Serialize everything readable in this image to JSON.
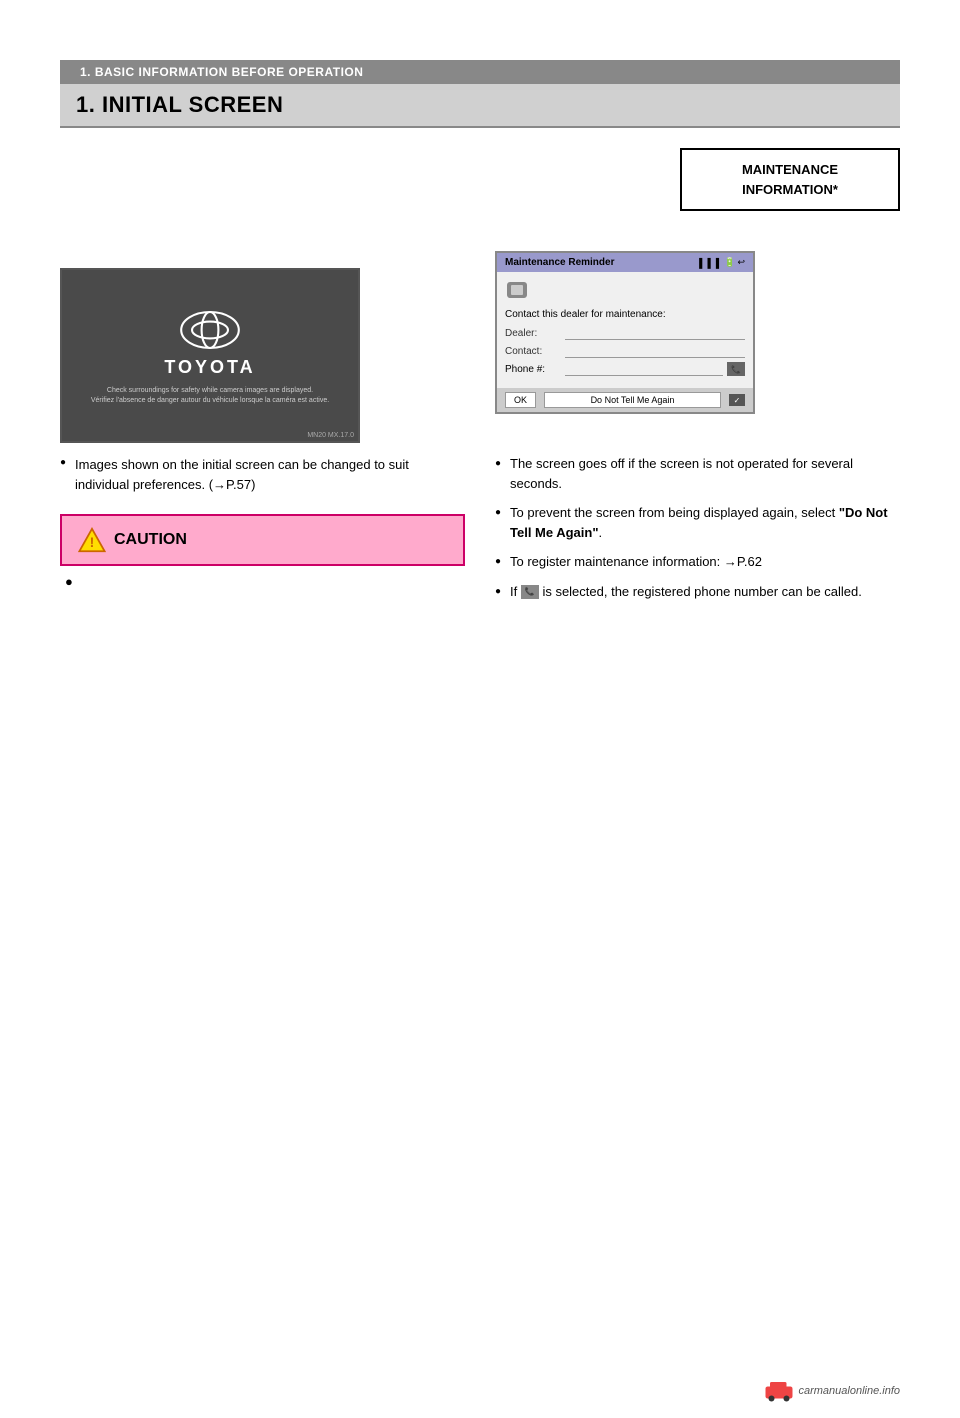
{
  "page": {
    "section_header": "1. BASIC INFORMATION BEFORE OPERATION",
    "main_title": "1. INITIAL SCREEN"
  },
  "maintenance_box": {
    "line1": "MAINTENANCE",
    "line2": "INFORMATION*"
  },
  "toyota_screen": {
    "brand": "TOYOTA",
    "safety_text_line1": "Check surroundings for safety while camera images are displayed.",
    "safety_text_line2": "Vérifiez l'absence de danger autour du véhicule lorsque la caméra est active.",
    "label": "MN20 MX.17.0"
  },
  "left_bullet": {
    "text": "Images shown on the initial screen can be changed to suit individual preferences. (→P.57)"
  },
  "caution": {
    "title": "CAUTION",
    "bullet_text": ""
  },
  "maintenance_reminder_screen": {
    "title": "Maintenance Reminder",
    "contact_title": "Contact this dealer for maintenance:",
    "dealer_label": "Dealer:",
    "contact_label": "Contact:",
    "phone_label": "Phone #:",
    "ok_btn": "OK",
    "do_not_btn": "Do Not Tell Me Again"
  },
  "right_bullets": {
    "bullet1": "The screen goes off if the screen is not operated for several seconds.",
    "bullet2_prefix": "To prevent the screen from being displayed again, select ",
    "bullet2_bold": "\"Do Not Tell Me Again\"",
    "bullet2_suffix": ".",
    "bullet3_prefix": "To register maintenance information: →P.62",
    "bullet4_prefix": "If ",
    "bullet4_suffix": " is selected, the registered phone number can be called."
  },
  "watermark": {
    "text": "carmanualonline.info"
  }
}
